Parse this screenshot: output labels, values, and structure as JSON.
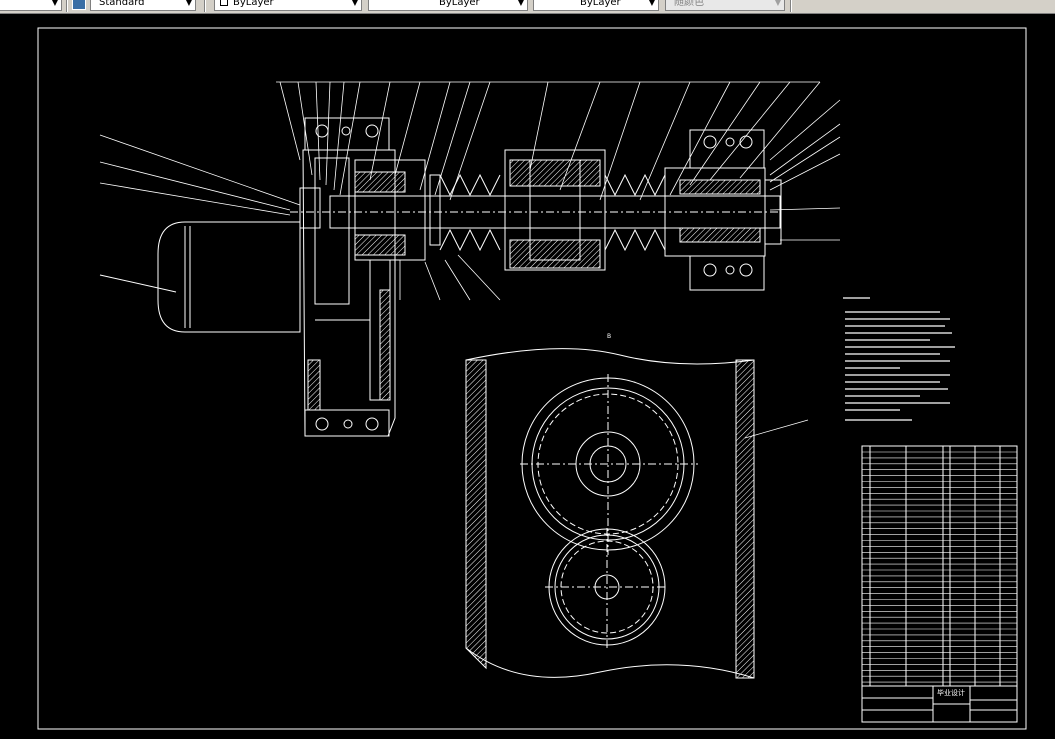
{
  "toolbar": {
    "textstyle_value": "Standard",
    "layer_value": "ByLayer",
    "linetype_value": "ByLayer",
    "lineweight_value": "ByLayer",
    "color_value": "随颜色"
  },
  "drawing": {
    "view_label": "B",
    "title_block": {
      "heading": "毕业设计"
    }
  },
  "colors": {
    "toolbar_bg": "#d4d0c8",
    "canvas_bg": "#000000",
    "lines": "#ffffff"
  }
}
